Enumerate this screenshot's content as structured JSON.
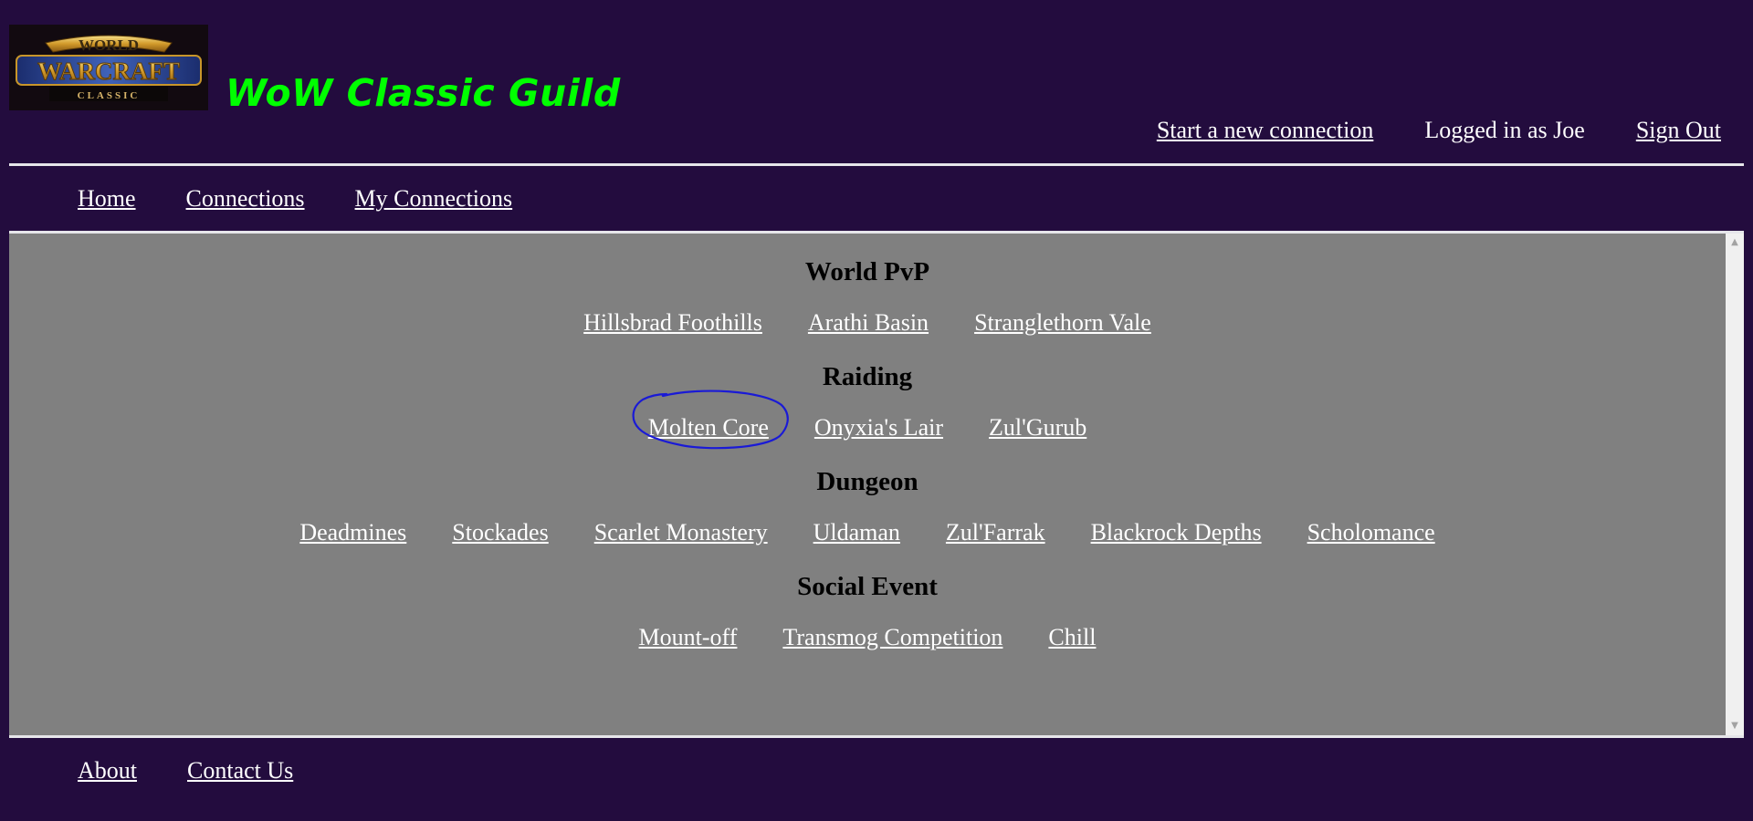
{
  "header": {
    "logo": {
      "line1": "WORLD",
      "line2": "WARCRAFT",
      "line3": "CLASSIC"
    },
    "title": "WoW Classic Guild",
    "new_connection_label": "Start a new connection",
    "logged_in_text": "Logged in as Joe",
    "sign_out_label": "Sign Out"
  },
  "nav": {
    "home": "Home",
    "connections": "Connections",
    "my_connections": "My Connections"
  },
  "sections": {
    "pvp": {
      "heading": "World PvP",
      "links": [
        "Hillsbrad Foothills",
        "Arathi Basin",
        "Stranglethorn Vale"
      ]
    },
    "raiding": {
      "heading": "Raiding",
      "links": [
        "Molten Core",
        "Onyxia's Lair",
        "Zul'Gurub"
      ]
    },
    "dungeon": {
      "heading": "Dungeon",
      "links": [
        "Deadmines",
        "Stockades",
        "Scarlet Monastery",
        "Uldaman",
        "Zul'Farrak",
        "Blackrock Depths",
        "Scholomance"
      ]
    },
    "social": {
      "heading": "Social Event",
      "links": [
        "Mount-off",
        "Transmog Competition",
        "Chill"
      ]
    }
  },
  "footer": {
    "about": "About",
    "contact": "Contact Us"
  },
  "icons": {
    "scroll_up": "scroll-up-arrow-icon",
    "scroll_down": "scroll-down-arrow-icon"
  },
  "colors": {
    "page_background": "#230c3e",
    "content_background": "#808080",
    "title_green": "#00ff00",
    "link_white": "#ffffff",
    "annotation_blue": "#1a1ad6"
  }
}
